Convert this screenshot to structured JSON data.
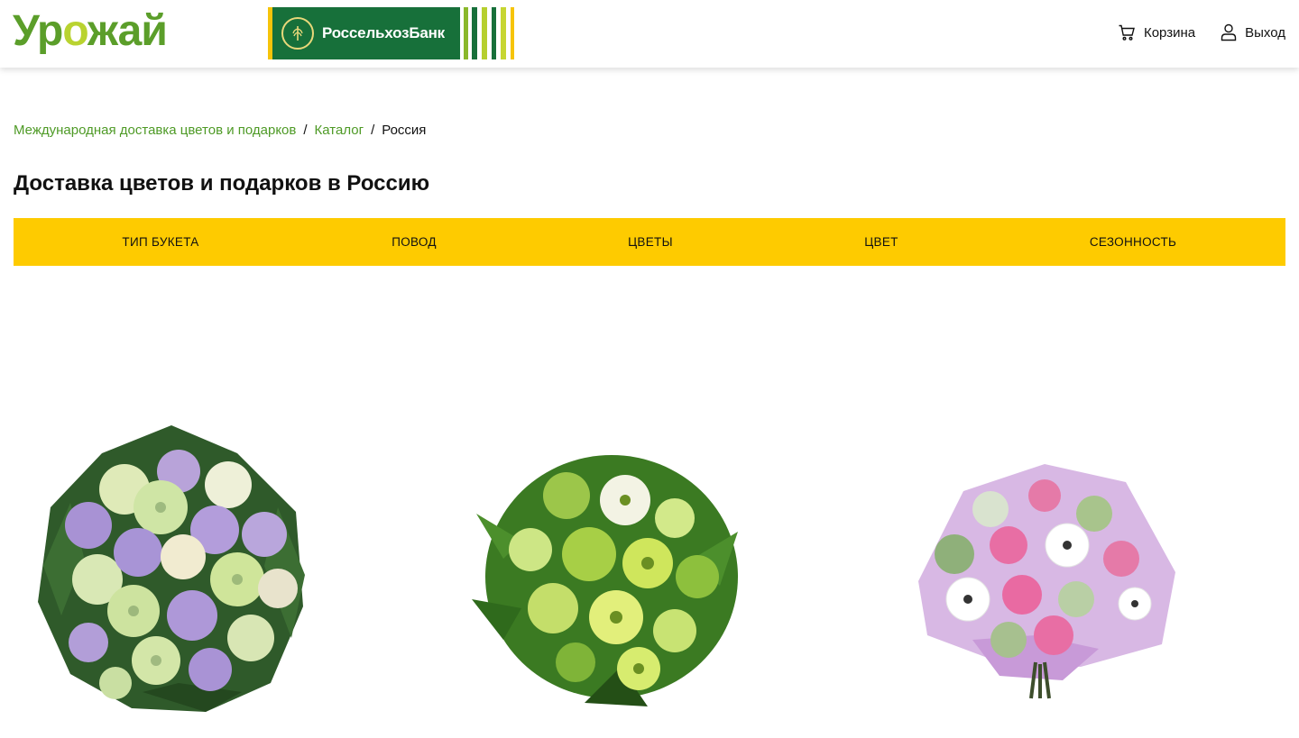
{
  "header": {
    "logo_text": "Урожай",
    "bank_name": "РоссельхозБанк",
    "cart_label": "Корзина",
    "logout_label": "Выход"
  },
  "breadcrumb": {
    "items": [
      {
        "label": "Международная доставка цветов и подарков"
      },
      {
        "label": "Каталог"
      }
    ],
    "separator": "/",
    "current": "Россия"
  },
  "page": {
    "title": "Доставка цветов и подарков в Россию"
  },
  "filters": [
    {
      "label": "ТИП БУКЕТА"
    },
    {
      "label": "ПОВОД"
    },
    {
      "label": "ЦВЕТЫ"
    },
    {
      "label": "ЦВЕТ"
    },
    {
      "label": "СЕЗОННОСТЬ"
    }
  ],
  "products": [
    {
      "image": "bouquet-lilac-green-hydrangea"
    },
    {
      "image": "bouquet-green-gerbera"
    },
    {
      "image": "bouquet-pink-rose-white-gerbera"
    }
  ],
  "colors": {
    "brand_green": "#4e9a26",
    "filter_bar": "#fecb00",
    "bank_green": "#17703a"
  }
}
